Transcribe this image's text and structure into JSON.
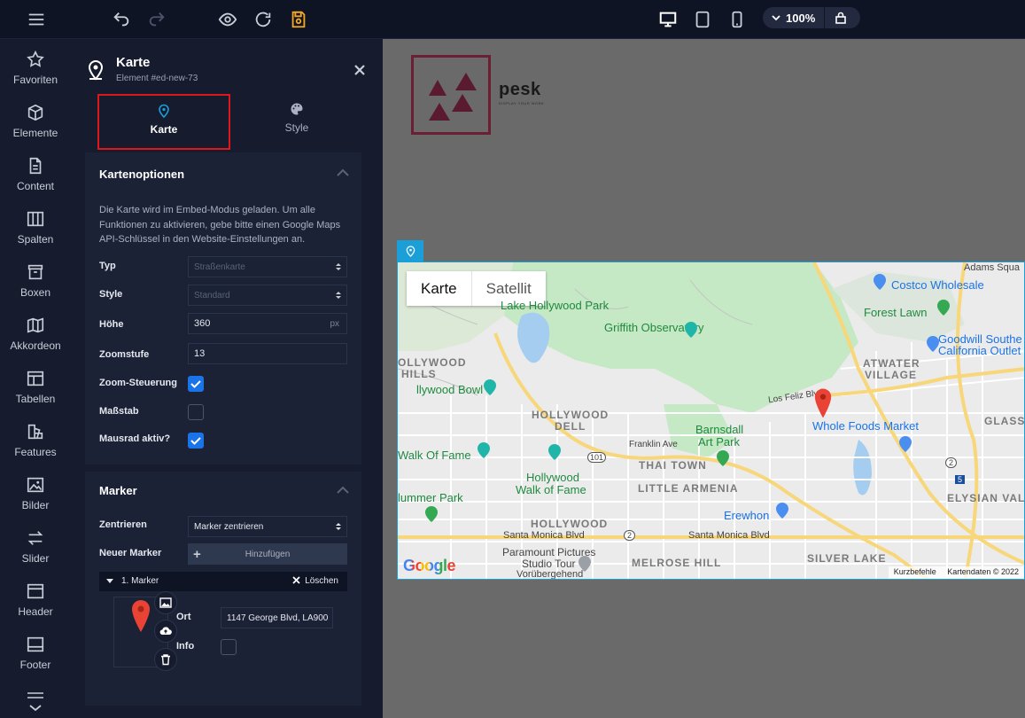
{
  "topbar": {
    "zoom": "100%",
    "colors": {
      "accent": "#f5a623"
    }
  },
  "iconbar": {
    "items": [
      {
        "label": "Favoriten",
        "icon": "star-icon"
      },
      {
        "label": "Elemente",
        "icon": "cube-icon"
      },
      {
        "label": "Content",
        "icon": "document-icon"
      },
      {
        "label": "Spalten",
        "icon": "columns-icon"
      },
      {
        "label": "Boxen",
        "icon": "box-icon"
      },
      {
        "label": "Akkordeon",
        "icon": "map-fold-icon"
      },
      {
        "label": "Tabellen",
        "icon": "table-icon"
      },
      {
        "label": "Features",
        "icon": "shapes-icon"
      },
      {
        "label": "Bilder",
        "icon": "image-icon"
      },
      {
        "label": "Slider",
        "icon": "arrows-icon"
      },
      {
        "label": "Header",
        "icon": "header-icon"
      },
      {
        "label": "Footer",
        "icon": "footer-icon"
      }
    ]
  },
  "panel": {
    "title": "Karte",
    "subtitle": "Element #ed-new-73",
    "tabs": [
      {
        "label": "Karte",
        "icon": "map-pin-icon",
        "active": true
      },
      {
        "label": "Style",
        "icon": "palette-icon",
        "active": false
      }
    ],
    "options": {
      "title": "Kartenoptionen",
      "description": "Die Karte wird im Embed-Modus geladen. Um alle Funktionen zu aktivieren, gebe bitte einen Google Maps API-Schlüssel in den Website-Einstellungen an.",
      "typ_label": "Typ",
      "typ_value": "Straßenkarte",
      "style_label": "Style",
      "style_value": "Standard",
      "hoehe_label": "Höhe",
      "hoehe_value": "360",
      "hoehe_unit": "px",
      "zoom_label": "Zoomstufe",
      "zoom_value": "13",
      "zoomctrl_label": "Zoom-Steuerung",
      "massstab_label": "Maßstab",
      "mausrad_label": "Mausrad aktiv?"
    },
    "marker": {
      "title": "Marker",
      "zentrieren_label": "Zentrieren",
      "zentrieren_value": "Marker zentrieren",
      "neuer_label": "Neuer Marker",
      "add_label": "Hinzufügen",
      "item_label": "1. Marker",
      "delete_label": "Löschen",
      "ort_label": "Ort",
      "ort_value": "1147 George Blvd, LA900",
      "info_label": "Info"
    }
  },
  "canvas": {
    "logo_text": "pesk",
    "logo_tagline": "DISPLAY YOUR WORK",
    "map": {
      "type_buttons": [
        "Karte",
        "Satellit"
      ],
      "labels": {
        "adams": "Adams Squa",
        "costco": "Costco Wholesale",
        "forest": "Forest Lawn",
        "goodwill1": "Goodwill Southe",
        "goodwill2": "California Outlet",
        "lakehw": "Lake Hollywood Park",
        "griffith": "Griffith Observatory",
        "atwater1": "ATWATER",
        "atwater2": "VILLAGE",
        "hwhills1": "OLLYWOOD",
        "hwhills2": "HILLS",
        "bowl": "llywood Bowl",
        "losfeliz": "Los Feliz Blvd",
        "wholefoods": "Whole Foods Market",
        "glass": "GLASS",
        "hwdell1": "HOLLYWOOD",
        "hwdell2": "DELL",
        "barnsdall1": "Barnsdall",
        "barnsdall2": "Art Park",
        "franklin": "Franklin Ave",
        "walkfame": "Walk Of Fame",
        "thaitown": "THAI TOWN",
        "hwwalk1": "Hollywood",
        "hwwalk2": "Walk of Fame",
        "littlearmenia": "LITTLE ARMENIA",
        "elysian": "ELYSIAN VALL",
        "hummer": "lummer Park",
        "erewhon": "Erewhon",
        "hollywood": "HOLLYWOOD",
        "smb1": "Santa Monica Blvd",
        "smb2": "Santa Monica Blvd",
        "paramount1": "Paramount Pictures",
        "paramount2": "Studio Tour",
        "paramount3": "Vorübergehend",
        "melrose": "MELROSE HILL",
        "silverlake": "SILVER LAKE",
        "r101a": "101",
        "r101b": "101",
        "r2a": "2",
        "r2b": "2",
        "r5": "5"
      },
      "shortcuts": "Kurzbefehle",
      "attribution": "Kartendaten © 2022",
      "google": "Google"
    }
  }
}
